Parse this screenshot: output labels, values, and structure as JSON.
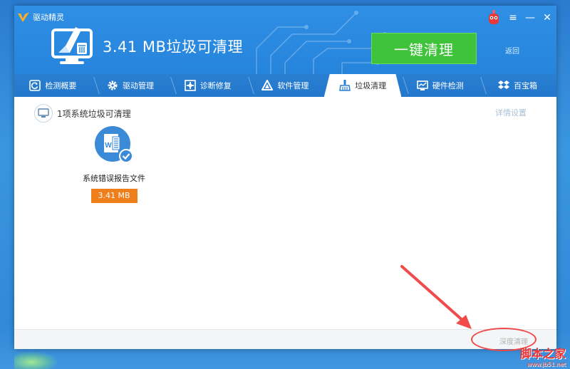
{
  "app": {
    "name": "驱动精灵",
    "headline": "3.41 MB垃圾可清理",
    "one_click_label": "一键清理",
    "back_label": "返回"
  },
  "controls": {
    "menu_icon": "≡",
    "minimize_icon": "—",
    "close_icon": "✕"
  },
  "tabs": [
    {
      "label": "检测概要",
      "icon": "refresh-icon"
    },
    {
      "label": "驱动管理",
      "icon": "gear-icon"
    },
    {
      "label": "诊断修复",
      "icon": "repair-icon"
    },
    {
      "label": "软件管理",
      "icon": "software-icon"
    },
    {
      "label": "垃圾清理",
      "icon": "broom-icon",
      "active": true
    },
    {
      "label": "硬件检测",
      "icon": "monitor-icon"
    },
    {
      "label": "百宝箱",
      "icon": "toolbox-icon"
    }
  ],
  "content": {
    "section_title": "1项系统垃圾可清理",
    "detail_settings": "详情设置",
    "items": [
      {
        "name": "系统错误报告文件",
        "size": "3.41 MB",
        "checked": true
      }
    ],
    "deep_clean": "深度清理"
  },
  "watermark": {
    "title": "脚本之家",
    "url": "www.jb51.net"
  },
  "colors": {
    "header_blue": "#2f8fe4",
    "green_button": "#3fc33a",
    "orange_badge": "#ef7f1a",
    "annotation_red": "#f04a4a"
  }
}
